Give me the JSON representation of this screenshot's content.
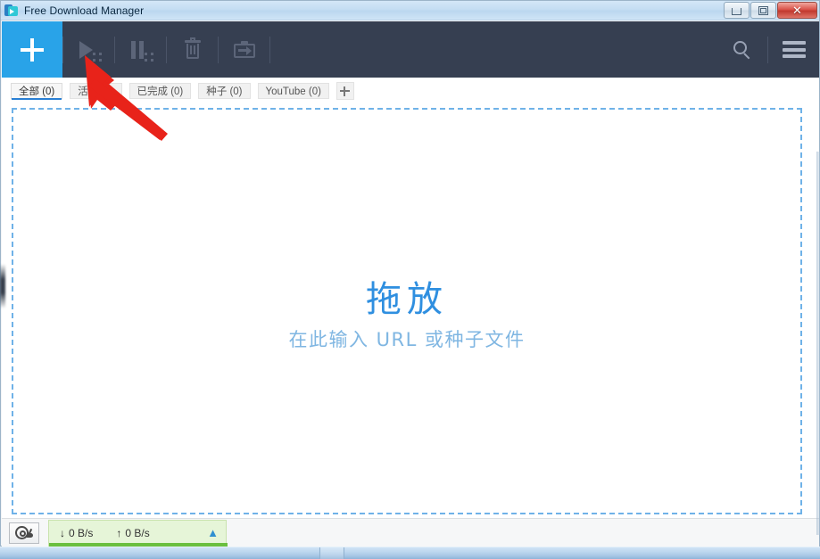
{
  "window": {
    "title": "Free Download Manager",
    "app_icon": "download-manager-icon",
    "controls": {
      "minimize": "minimize-icon",
      "maximize": "maximize-icon",
      "close": "✕"
    }
  },
  "toolbar": {
    "add_label": "+",
    "buttons": [
      {
        "name": "start-download",
        "icon": "play-icon",
        "enabled": false
      },
      {
        "name": "pause-download",
        "icon": "pause-icon",
        "enabled": false
      },
      {
        "name": "delete-download",
        "icon": "trash-icon",
        "enabled": false
      },
      {
        "name": "move-download",
        "icon": "export-box-icon",
        "enabled": false
      }
    ],
    "search_icon": "search-icon",
    "menu_icon": "hamburger-menu-icon",
    "background_color": "#363f51",
    "accent_color": "#29a3e8"
  },
  "tabs": {
    "items": [
      {
        "label": "全部 (0)",
        "active": true
      },
      {
        "label": "活动 (0)",
        "active": false
      },
      {
        "label": "已完成 (0)",
        "active": false
      },
      {
        "label": "种子 (0)",
        "active": false
      },
      {
        "label": "YouTube (0)",
        "active": false
      }
    ],
    "add_tab_label": "+",
    "active_underline_color": "#2a7fd4"
  },
  "dropzone": {
    "title": "拖放",
    "subtitle": "在此输入 URL 或种子文件",
    "border_color": "#6fb2e8",
    "title_color": "#2f8fe0",
    "subtitle_color": "#7fb6e2"
  },
  "statusbar": {
    "speed_limit_icon": "snail-icon",
    "download_arrow": "↓",
    "download_speed": "0 B/s",
    "upload_arrow": "↑",
    "upload_speed": "0 B/s",
    "expand_icon": "chevron-up-icon",
    "panel_color": "#e6f5d8",
    "progress_color": "#6abf3f"
  },
  "annotation": {
    "arrow_color": "#e8231a",
    "points_to": "start-download"
  }
}
